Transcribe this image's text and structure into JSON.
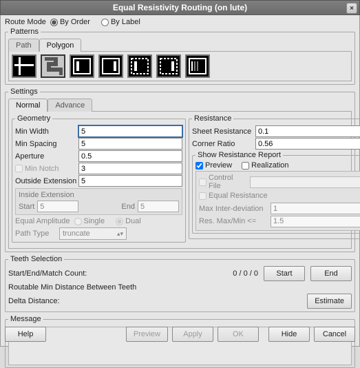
{
  "window": {
    "title": "Equal Resistivity Routing (on lute)",
    "close_icon": "×"
  },
  "route_mode": {
    "label": "Route Mode",
    "options": {
      "by_order": "By Order",
      "by_label": "By Label"
    },
    "selected": "by_order"
  },
  "patterns": {
    "legend": "Patterns",
    "tabs": {
      "path": "Path",
      "polygon": "Polygon",
      "active": "polygon"
    }
  },
  "settings": {
    "legend": "Settings",
    "tabs": {
      "normal": "Normal",
      "advance": "Advance",
      "active": "normal"
    },
    "geometry": {
      "legend": "Geometry",
      "min_width": {
        "label": "Min Width",
        "value": "5"
      },
      "min_spacing": {
        "label": "Min Spacing",
        "value": "5"
      },
      "aperture": {
        "label": "Aperture",
        "value": "0.5"
      },
      "min_notch": {
        "label": "Min Notch",
        "value": "3",
        "enabled": false
      },
      "outside_ext": {
        "label": "Outside Extension",
        "value": "5"
      },
      "inside_ext": {
        "legend": "Inside Extension",
        "start": {
          "label": "Start",
          "value": "5"
        },
        "end": {
          "label": "End",
          "value": "5"
        }
      },
      "equal_amplitude": {
        "label": "Equal Amplitude",
        "single": "Single",
        "dual": "Dual",
        "selected": "dual"
      },
      "path_type": {
        "label": "Path Type",
        "value": "truncate"
      }
    },
    "resistance": {
      "legend": "Resistance",
      "sheet_resistance": {
        "label": "Sheet Resistance",
        "value": "0.1"
      },
      "corner_ratio": {
        "label": "Corner Ratio",
        "value": "0.56"
      },
      "report": {
        "legend": "Show Resistance Report",
        "preview": {
          "label": "Preview",
          "checked": true
        },
        "realization": {
          "label": "Realization",
          "checked": false
        },
        "control_file": {
          "label": "Control File",
          "value": ""
        },
        "equal_resistance": {
          "label": "Equal Resistance",
          "checked": false
        },
        "max_inter_dev": {
          "label": "Max Inter-deviation",
          "value": "1"
        },
        "res_maxmin": {
          "label": "Res. Max/Min <=",
          "value": "1.5"
        }
      }
    }
  },
  "teeth": {
    "legend": "Teeth Selection",
    "start_end_match": {
      "label": "Start/End/Match Count:",
      "value": "0 / 0 / 0"
    },
    "start_btn": "Start",
    "end_btn": "End",
    "routable_label": "Routable Min Distance Between Teeth",
    "delta_distance": {
      "label": "Delta Distance:"
    },
    "estimate_btn": "Estimate"
  },
  "message": {
    "legend": "Message"
  },
  "buttons": {
    "help": "Help",
    "preview": "Preview",
    "apply": "Apply",
    "ok": "OK",
    "hide": "Hide",
    "cancel": "Cancel"
  }
}
